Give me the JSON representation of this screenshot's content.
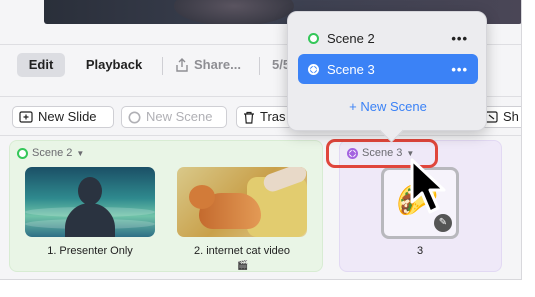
{
  "toolbar": {
    "edit_label": "Edit",
    "playback_label": "Playback",
    "share_label": "Share...",
    "share_count": "5/5"
  },
  "actions": {
    "new_slide": "New Slide",
    "new_scene": "New Scene",
    "trash": "Tras",
    "show": "Sh"
  },
  "scenes": [
    {
      "name": "Scene 2",
      "color": "#34c759",
      "slides": [
        {
          "caption": "1. Presenter Only"
        },
        {
          "caption": "2. internet cat video"
        }
      ]
    },
    {
      "name": "Scene 3",
      "color": "#a463e0",
      "slides": [
        {
          "caption": "3"
        }
      ]
    }
  ],
  "popover": {
    "items": [
      {
        "label": "Scene 2",
        "menu": "•••"
      },
      {
        "label": "Scene 3",
        "menu": "•••"
      }
    ],
    "new_scene": "+ New Scene"
  },
  "colors": {
    "accent": "#3b82f6",
    "highlight": "#e0463c"
  }
}
